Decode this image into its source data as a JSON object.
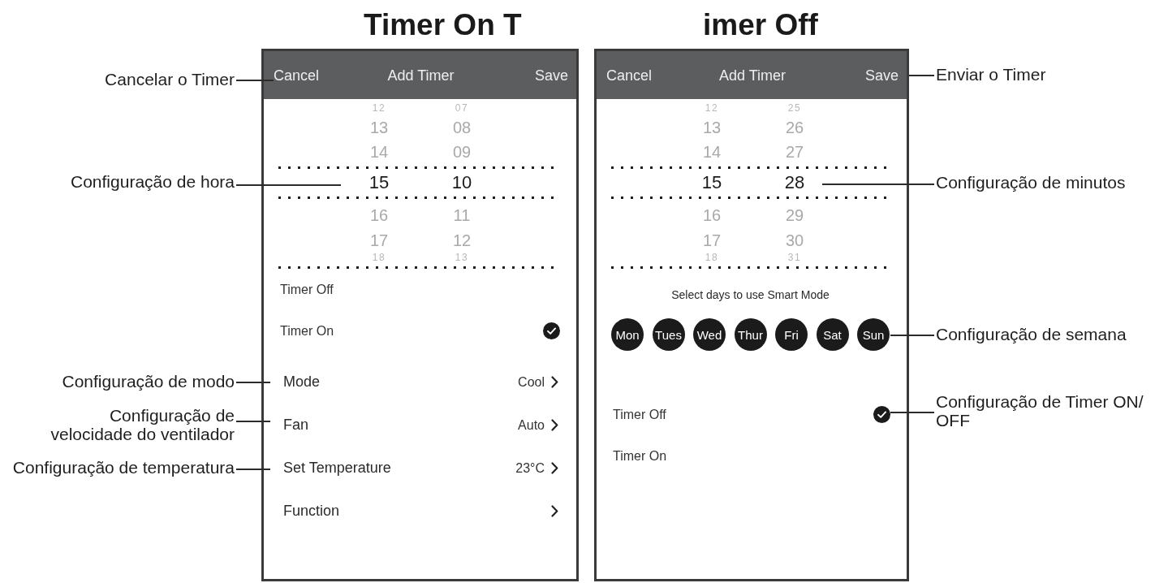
{
  "panels": [
    {
      "heading": "Timer On T",
      "header": {
        "cancel": "Cancel",
        "title": "Add Timer",
        "save": "Save"
      },
      "sections": [
        {
          "kind": "picker",
          "rows": [
            {
              "hour": "12",
              "minute": "07",
              "selected": false
            },
            {
              "hour": "13",
              "minute": "08",
              "selected": false
            },
            {
              "hour": "14",
              "minute": "09",
              "selected": false
            },
            {
              "hour": "15",
              "minute": "10",
              "selected": true
            },
            {
              "hour": "16",
              "minute": "11",
              "selected": false
            },
            {
              "hour": "17",
              "minute": "12",
              "selected": false
            },
            {
              "hour": "18",
              "minute": "13",
              "selected": false
            }
          ]
        },
        {
          "kind": "timer_options",
          "options": [
            {
              "label": "Timer Off",
              "checked": false
            },
            {
              "label": "Timer On",
              "checked": true
            }
          ]
        },
        {
          "kind": "settings",
          "items": [
            {
              "label": "Mode",
              "value": "Cool"
            },
            {
              "label": "Fan",
              "value": "Auto"
            },
            {
              "label": "Set Temperature",
              "value": "23°C"
            },
            {
              "label": "Function"
            }
          ]
        }
      ]
    },
    {
      "heading": "imer Off",
      "header": {
        "cancel": "Cancel",
        "title": "Add Timer",
        "save": "Save"
      },
      "sections": [
        {
          "kind": "picker",
          "rows": [
            {
              "hour": "12",
              "minute": "25",
              "selected": false
            },
            {
              "hour": "13",
              "minute": "26",
              "selected": false
            },
            {
              "hour": "14",
              "minute": "27",
              "selected": false
            },
            {
              "hour": "15",
              "minute": "28",
              "selected": true
            },
            {
              "hour": "16",
              "minute": "29",
              "selected": false
            },
            {
              "hour": "17",
              "minute": "30",
              "selected": false
            },
            {
              "hour": "18",
              "minute": "31",
              "selected": false
            }
          ]
        },
        {
          "kind": "days",
          "caption": "Select days to use Smart Mode",
          "days": [
            {
              "label": "Mon",
              "selected": true
            },
            {
              "label": "Tues",
              "selected": true
            },
            {
              "label": "Wed",
              "selected": true
            },
            {
              "label": "Thur",
              "selected": true
            },
            {
              "label": "Fri",
              "selected": true
            },
            {
              "label": "Sat",
              "selected": true
            },
            {
              "label": "Sun",
              "selected": true
            }
          ]
        },
        {
          "kind": "timer_options",
          "options": [
            {
              "label": "Timer Off",
              "checked": true
            },
            {
              "label": "Timer On",
              "checked": false
            }
          ]
        }
      ]
    }
  ],
  "callouts": {
    "left": [
      "Cancelar o Timer",
      "Configuração de hora",
      "Configuração de modo",
      "Configuração de velocidade do ventilador",
      "Configuração de temperatura"
    ],
    "right": [
      "Enviar o Timer",
      "Configuração de minutos",
      "Configuração de semana",
      "Configuração de Timer ON/ OFF"
    ]
  }
}
